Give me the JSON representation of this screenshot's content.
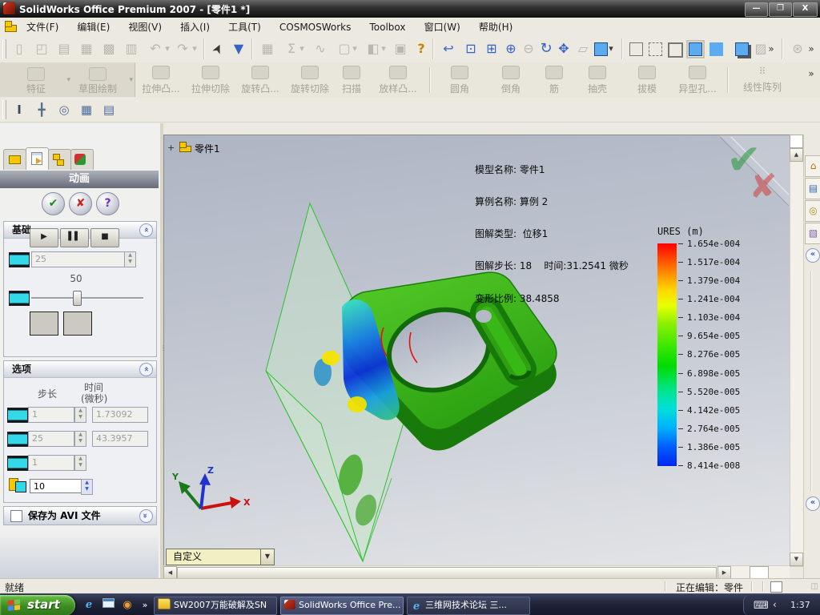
{
  "titlebar": {
    "title": "SolidWorks Office Premium 2007 - [零件1 *]"
  },
  "menubar": {
    "items": [
      "文件(F)",
      "编辑(E)",
      "视图(V)",
      "插入(I)",
      "工具(T)",
      "COSMOSWorks",
      "Toolbox",
      "窗口(W)",
      "帮助(H)"
    ]
  },
  "features_toolbar": {
    "tabs": [
      "特征",
      "草图绘制"
    ],
    "buttons": [
      "拉伸凸...",
      "拉伸切除",
      "旋转凸...",
      "旋转切除",
      "扫描",
      "放样凸...",
      "圆角",
      "倒角",
      "筋",
      "抽壳",
      "拔模",
      "异型孔...",
      "线性阵列"
    ]
  },
  "animation_panel": {
    "title": "动画",
    "basic_group": "基础",
    "options_group": "选项",
    "avi_group": "保存为 AVI 文件",
    "frames": "25",
    "speed": "50",
    "step_header": "步长",
    "time_header_1": "时间",
    "time_header_2": "(微秒)",
    "row1_step": "1",
    "row1_time": "1.73092",
    "row2_step": "25",
    "row2_time": "43.3957",
    "row3_step": "1",
    "fps": "10"
  },
  "viewport": {
    "tree_item": "零件1",
    "info_line1": "模型名称: 零件1",
    "info_line2": "算例名称: 算例 2",
    "info_line3": "图解类型:  位移1",
    "info_line4": "图解步长: 18    时间:31.2541 微秒",
    "info_line5": "变形比例: 38.4858",
    "orientation": "自定义",
    "triad_x": "X",
    "triad_y": "Y",
    "triad_z": "Z"
  },
  "legend": {
    "title": "URES (m)",
    "values": [
      "1.654e-004",
      "1.517e-004",
      "1.379e-004",
      "1.241e-004",
      "1.103e-004",
      "9.654e-005",
      "8.276e-005",
      "6.898e-005",
      "5.520e-005",
      "4.142e-005",
      "2.764e-005",
      "1.386e-005",
      "8.414e-008"
    ]
  },
  "statusbar": {
    "ready": "就绪",
    "editing": "正在编辑：零件"
  },
  "taskbar": {
    "start_label": "start",
    "task1": "SW2007万能破解及SN",
    "task2": "SolidWorks Office Pre...",
    "task3": "三维网技术论坛 三...",
    "time": "1:37"
  },
  "colors": {
    "model_green": "#35b514",
    "band_blue": "#0a30d8",
    "legend_top": "#ff0000",
    "legend_bottom": "#0026f0",
    "taskbar_dark": "#202438",
    "start_green": "#3d8c22"
  }
}
